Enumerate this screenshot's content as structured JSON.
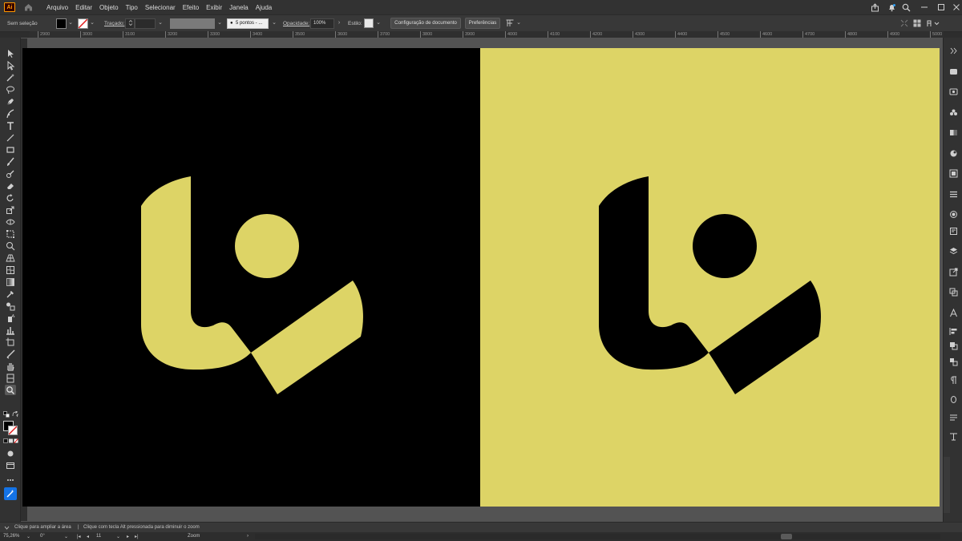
{
  "app": {
    "logo_text": "Ai",
    "brand_color": "#ff9a00"
  },
  "menu": {
    "items": [
      "Arquivo",
      "Editar",
      "Objeto",
      "Tipo",
      "Selecionar",
      "Efeito",
      "Exibir",
      "Janela",
      "Ajuda"
    ]
  },
  "control_bar": {
    "selection_label": "Sem seleção",
    "stroke_label": "Traçado:",
    "brush_value": "5 pontos - ...",
    "opacity_label": "Opacidade:",
    "opacity_value": "100%",
    "style_label": "Estilo:",
    "doc_setup_button": "Configuração de documento",
    "preferences_button": "Preferências"
  },
  "ruler": {
    "labels": [
      "2900",
      "3000",
      "3100",
      "3200",
      "3300",
      "3400",
      "3500",
      "3600",
      "3700",
      "3800",
      "3900",
      "4000",
      "4100",
      "4200",
      "4300",
      "4400",
      "4500",
      "4600",
      "4700",
      "4800",
      "4900",
      "5000"
    ]
  },
  "artboards": {
    "dark_bg": "#000000",
    "dark_mark": "#ddd466",
    "light_bg": "#ddd466",
    "light_mark": "#000000"
  },
  "hint_bar": {
    "text_a": "Clique para ampliar a área",
    "separator": "|",
    "text_b": "Clique com tecla Alt pressionada para diminuir o zoom"
  },
  "status_bar": {
    "zoom": "75,26%",
    "rotation": "0°",
    "artboard_number": "11",
    "current_tool": "Zoom"
  }
}
